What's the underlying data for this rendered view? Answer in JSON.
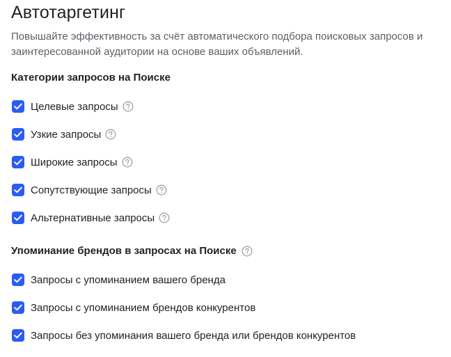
{
  "title": "Автотаргетинг",
  "description": "Повышайте эффективность за счёт автоматического подбора поисковых запросов и заинтересованной аудитории на основе ваших объявлений.",
  "colors": {
    "accent": "#2a5cf5",
    "help_icon": "#9ea1a8",
    "muted_text": "#5b5f66"
  },
  "search_categories": {
    "title": "Категории запросов на Поиске",
    "items": [
      {
        "label": "Целевые запросы",
        "checked": true,
        "help_icon": "question-circle-icon"
      },
      {
        "label": "Узкие запросы",
        "checked": true,
        "help_icon": "question-circle-icon"
      },
      {
        "label": "Широкие запросы",
        "checked": true,
        "help_icon": "question-circle-icon"
      },
      {
        "label": "Сопутствующие запросы",
        "checked": true,
        "help_icon": "question-circle-icon"
      },
      {
        "label": "Альтернативные запросы",
        "checked": true,
        "help_icon": "question-circle-icon"
      }
    ]
  },
  "brand_mentions": {
    "title": "Упоминание брендов в запросах на Поиске",
    "help_icon": "question-circle-icon",
    "items": [
      {
        "label": "Запросы с упоминанием вашего бренда",
        "checked": true
      },
      {
        "label": "Запросы с упоминанием брендов конкурентов",
        "checked": true
      },
      {
        "label": "Запросы без упоминания вашего бренда или брендов конкурентов",
        "checked": true
      }
    ]
  }
}
